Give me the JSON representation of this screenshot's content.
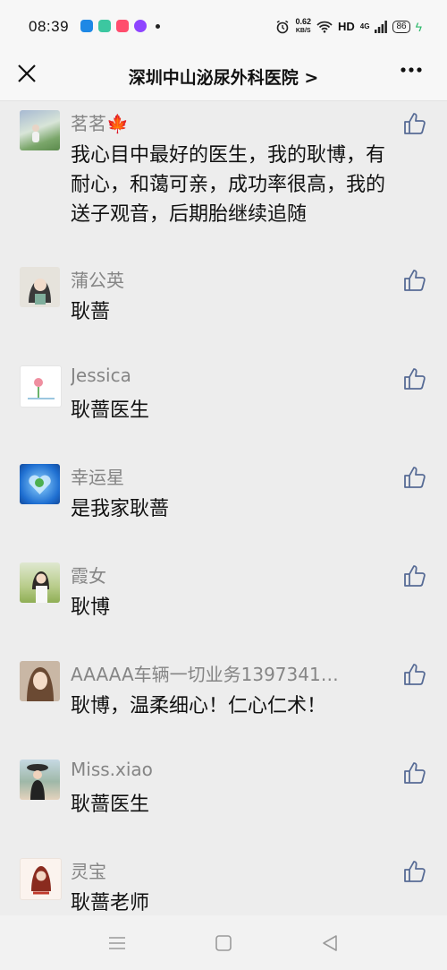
{
  "status_bar": {
    "time": "08:39",
    "net_speed_value": "0.62",
    "net_speed_unit": "KB/S",
    "hd": "HD",
    "signal_type": "4G",
    "battery": "86"
  },
  "header": {
    "title": "深圳中山泌尿外科医院 >"
  },
  "comments": [
    {
      "name": "茗茗🍁",
      "text": "我心目中最好的医生，我的耿博，有耐心，和蔼可亲，成功率很高，我的送子观音，后期胎继续追随"
    },
    {
      "name": "蒲公英",
      "text": "耿蔷"
    },
    {
      "name": "Jessica",
      "text": "耿蔷医生"
    },
    {
      "name": "幸运星",
      "text": "是我家耿蔷"
    },
    {
      "name": "霞女",
      "text": "耿博"
    },
    {
      "name": "AAAAA车辆一切业务1397341…",
      "text": "耿博，温柔细心！仁心仁术！"
    },
    {
      "name": "Miss.xiao",
      "text": "耿蔷医生"
    },
    {
      "name": "灵宝",
      "text": "耿蔷老师"
    }
  ],
  "icons": {
    "close": "close-icon",
    "more": "more-icon",
    "like": "thumbs-up-icon",
    "nav_menu": "menu-icon",
    "nav_home": "home-square-icon",
    "nav_back": "back-triangle-icon"
  },
  "colors": {
    "background": "#ededed",
    "name_text": "#858585",
    "body_text": "#111111",
    "like_icon": "#576b95"
  }
}
